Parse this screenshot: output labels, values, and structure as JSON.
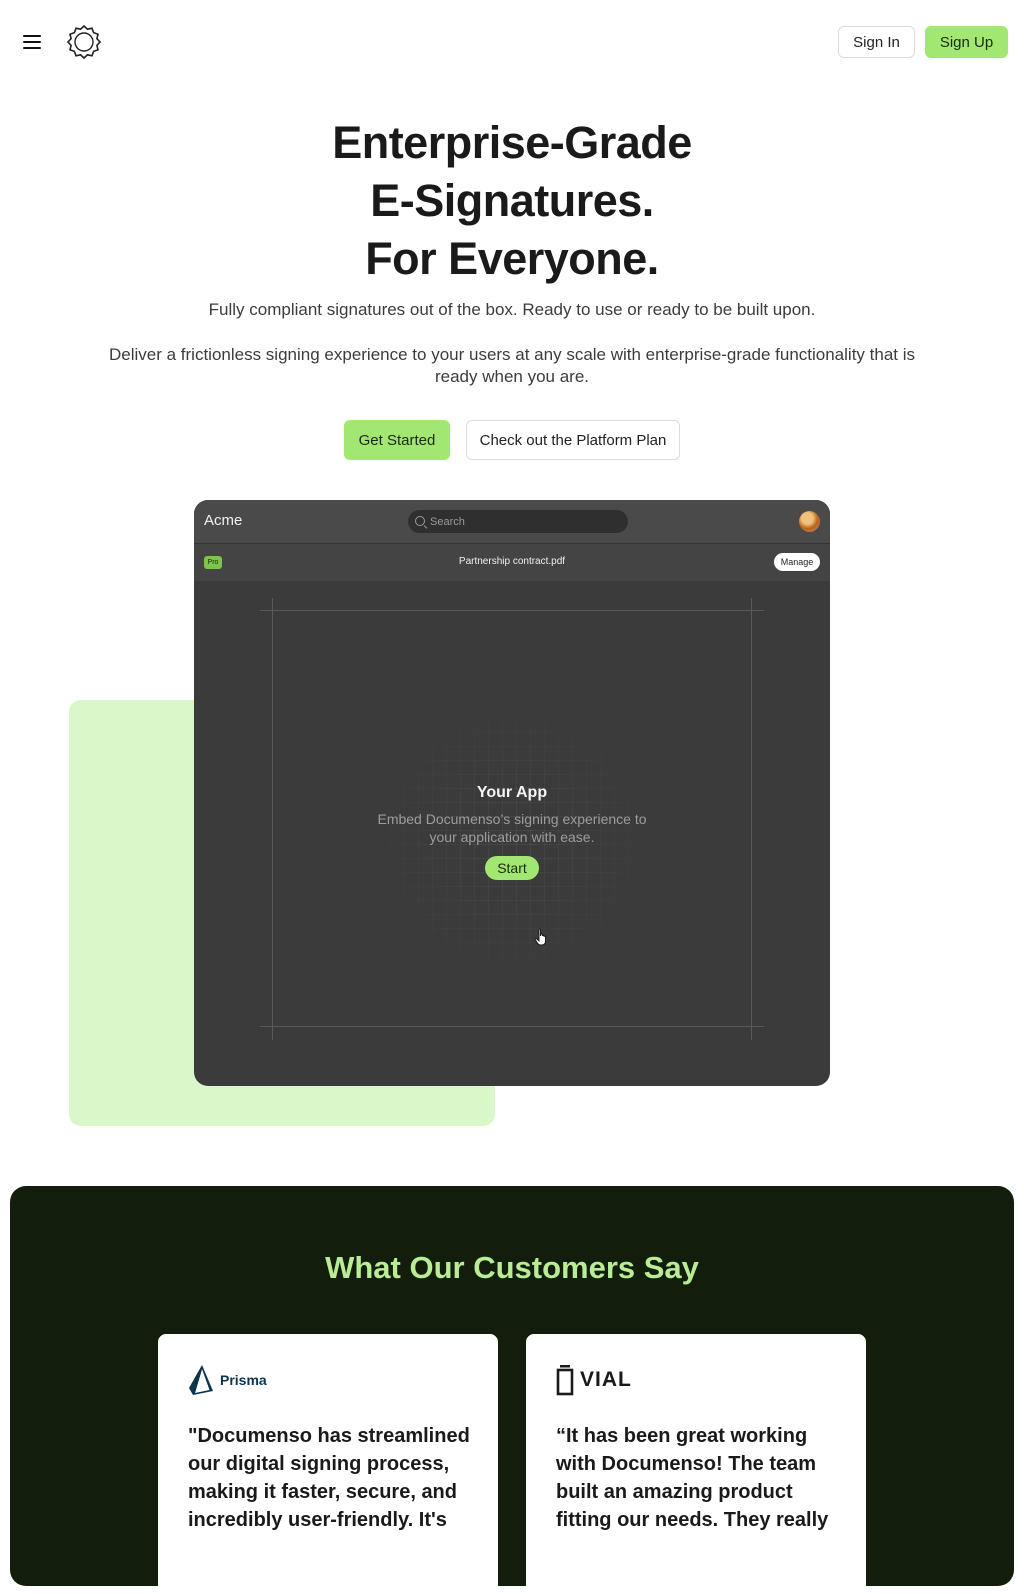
{
  "header": {
    "sign_in_label": "Sign In",
    "sign_up_label": "Sign Up"
  },
  "hero": {
    "title_lines": [
      "Enterprise-Grade",
      "E-Signatures.",
      "For Everyone."
    ],
    "subtitle": "Fully compliant signatures out of the box. Ready to use or ready to be built upon.",
    "description": "Deliver a frictionless signing experience to your users at any scale with enterprise-grade functionality that is ready when you are.",
    "primary_cta": "Get Started",
    "secondary_cta": "Check out the Platform Plan"
  },
  "mockup": {
    "app_name": "Acme",
    "search_placeholder": "Search",
    "badge": "Pro",
    "file_name": "Partnership contract.pdf",
    "manage_label": "Manage",
    "panel_title": "Your App",
    "panel_description": "Embed Documenso’s signing experience to your application with ease.",
    "start_label": "Start"
  },
  "testimonials": {
    "title": "What Our Customers Say",
    "items": [
      {
        "brand": "Prisma",
        "quote": "\"Documenso has streamlined our digital signing process, making it faster, secure, and incredibly user-friendly. It's"
      },
      {
        "brand": "VIAL",
        "quote": "“It has been great working with Documenso! The team built an amazing product fitting our needs. They really"
      }
    ]
  },
  "colors": {
    "accent_green": "#a2e771",
    "light_green": "#d9f7c8",
    "dark_green": "#121e0b",
    "heading_green": "#b9ec95",
    "app_dark": "#3b3b3b"
  }
}
